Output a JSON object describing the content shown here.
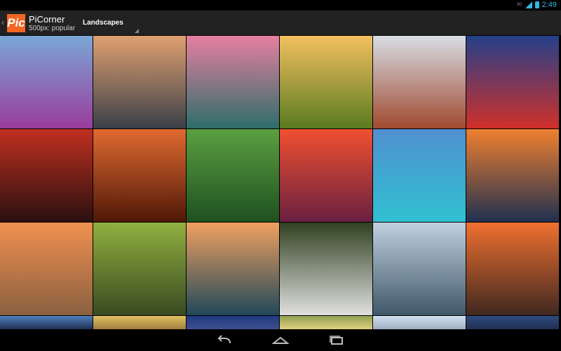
{
  "status_bar": {
    "network": "3G",
    "time": "2:49"
  },
  "action_bar": {
    "logo_text": "Pic",
    "title": "PiCorner",
    "subtitle": "500px: popular",
    "category": "Landscapes"
  },
  "tiles": [
    [
      "#7aa7d6",
      "#9a3c9c"
    ],
    [
      "#e0a070",
      "#3a4048"
    ],
    [
      "#e57fa0",
      "#2d6e6a"
    ],
    [
      "#f3c060",
      "#5a7a20"
    ],
    [
      "#d8dde5",
      "#a04a30"
    ],
    [
      "#24408a",
      "#d0302a"
    ],
    [
      "#c03020",
      "#2a1010"
    ],
    [
      "#e06a30",
      "#501808"
    ],
    [
      "#5aa040",
      "#1f5020"
    ],
    [
      "#f05030",
      "#6a2040"
    ],
    [
      "#5090d0",
      "#30c0d0"
    ],
    [
      "#f08030",
      "#203050"
    ],
    [
      "#f09050",
      "#8a6040"
    ],
    [
      "#90b040",
      "#3a4a20"
    ],
    [
      "#f0a060",
      "#204858"
    ],
    [
      "#304020",
      "#e0e0e0"
    ],
    [
      "#c0d0e0",
      "#405868"
    ],
    [
      "#f07030",
      "#402820"
    ],
    [
      "#5080c0",
      "#203050"
    ],
    [
      "#e0c060",
      "#a08040"
    ],
    [
      "#203880",
      "#405090"
    ],
    [
      "#90a050",
      "#e0d080"
    ],
    [
      "#d0e0f0",
      "#a0b0c0"
    ],
    [
      "#304a80",
      "#203050"
    ]
  ]
}
